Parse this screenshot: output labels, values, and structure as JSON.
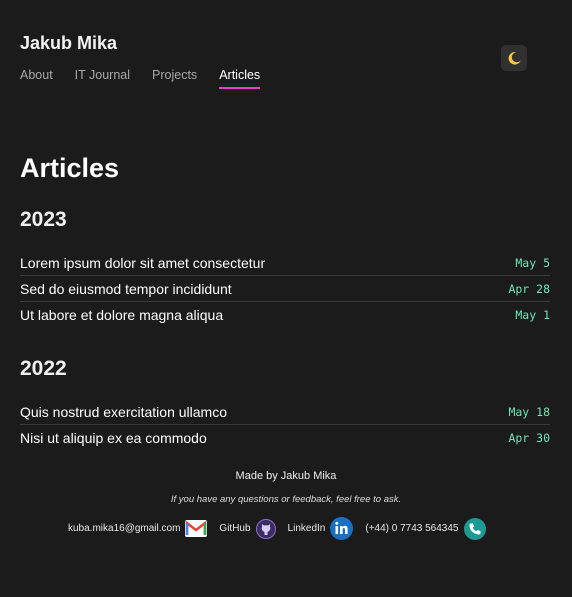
{
  "header": {
    "site_title": "Jakub Mika",
    "nav": [
      {
        "label": "About",
        "active": false
      },
      {
        "label": "IT Journal",
        "active": false
      },
      {
        "label": "Projects",
        "active": false
      },
      {
        "label": "Articles",
        "active": true
      }
    ],
    "theme_icon": "moon-icon"
  },
  "main": {
    "title": "Articles",
    "groups": [
      {
        "year": "2023",
        "articles": [
          {
            "title": "Lorem ipsum dolor sit amet consectetur",
            "date": "May 5"
          },
          {
            "title": "Sed do eiusmod tempor incididunt",
            "date": "Apr 28"
          },
          {
            "title": "Ut labore et dolore magna aliqua",
            "date": "May 1"
          }
        ]
      },
      {
        "year": "2022",
        "articles": [
          {
            "title": "Quis nostrud exercitation ullamco",
            "date": "May 18"
          },
          {
            "title": "Nisi ut aliquip ex ea commodo",
            "date": "Apr 30"
          }
        ]
      }
    ]
  },
  "footer": {
    "made_by": "Made by Jakub Mika",
    "note": "If you have any questions or feedback, feel free to ask.",
    "contacts": [
      {
        "label": "kuba.mika16@gmail.com",
        "icon": "gmail-icon"
      },
      {
        "label": "GitHub",
        "icon": "github-icon"
      },
      {
        "label": "LinkedIn",
        "icon": "linkedin-icon"
      },
      {
        "label": "(+44) 0 7743 564345",
        "icon": "phone-icon"
      }
    ]
  },
  "colors": {
    "background": "#1b1b1b",
    "accent": "#e040d0",
    "date": "#6ee7b7"
  }
}
